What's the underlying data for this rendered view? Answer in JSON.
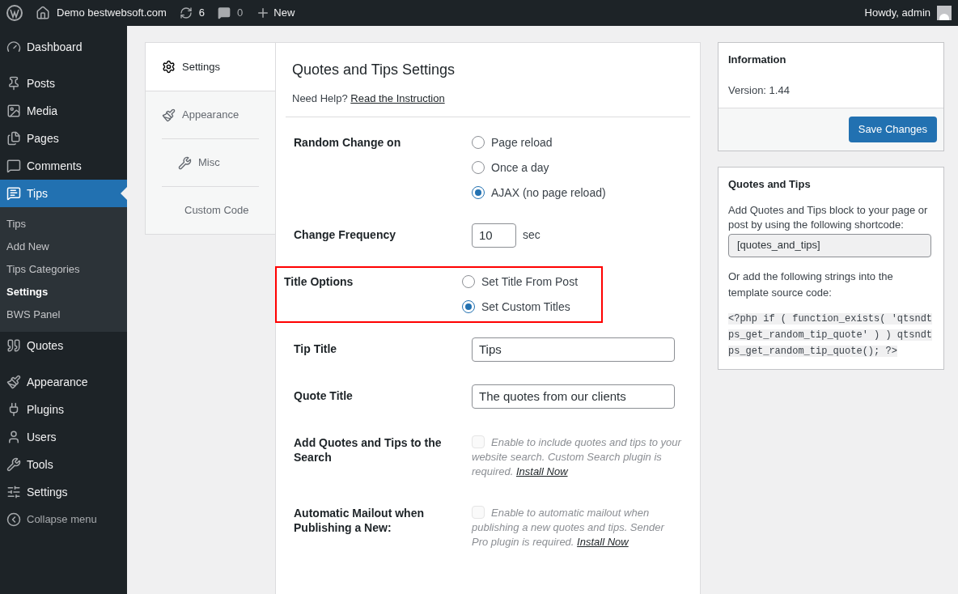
{
  "admin_bar": {
    "site_name": "Demo bestwebsoft.com",
    "updates_count": "6",
    "comments_count": "0",
    "new_label": "New",
    "greeting": "Howdy, admin"
  },
  "sidebar": {
    "items": [
      {
        "label": "Dashboard",
        "selected": false
      },
      {
        "label": "Posts",
        "selected": false
      },
      {
        "label": "Media",
        "selected": false
      },
      {
        "label": "Pages",
        "selected": false
      },
      {
        "label": "Comments",
        "selected": false
      },
      {
        "label": "Tips",
        "selected": true,
        "children": [
          {
            "label": "Tips",
            "selected": false
          },
          {
            "label": "Add New",
            "selected": false
          },
          {
            "label": "Tips Categories",
            "selected": false
          },
          {
            "label": "Settings",
            "selected": true
          },
          {
            "label": "BWS Panel",
            "selected": false
          }
        ]
      },
      {
        "label": "Quotes",
        "selected": false
      },
      {
        "label": "Appearance",
        "selected": false
      },
      {
        "label": "Plugins",
        "selected": false
      },
      {
        "label": "Users",
        "selected": false
      },
      {
        "label": "Tools",
        "selected": false
      },
      {
        "label": "Settings",
        "selected": false
      }
    ],
    "collapse_label": "Collapse menu"
  },
  "tabs": [
    {
      "label": "Settings",
      "selected": true
    },
    {
      "label": "Appearance",
      "selected": false
    },
    {
      "label": "Misc",
      "selected": false
    },
    {
      "label": "Custom Code",
      "selected": false
    }
  ],
  "settings": {
    "title": "Quotes and Tips Settings",
    "help_text": "Need Help?",
    "help_link": "Read the Instruction",
    "fields": [
      {
        "kind": "radio",
        "label": "Random Change on",
        "highlighted": false,
        "options": [
          {
            "label": "Page reload",
            "selected": false
          },
          {
            "label": "Once a day",
            "selected": false
          },
          {
            "label": "AJAX (no page reload)",
            "selected": true
          }
        ]
      },
      {
        "kind": "number",
        "label": "Change Frequency",
        "highlighted": false,
        "value": "10",
        "unit": "sec"
      },
      {
        "kind": "radio",
        "label": "Title Options",
        "highlighted": true,
        "options": [
          {
            "label": "Set Title From Post",
            "selected": false
          },
          {
            "label": "Set Custom Titles",
            "selected": true
          }
        ]
      },
      {
        "kind": "text",
        "label": "Tip Title",
        "highlighted": false,
        "value": "Tips"
      },
      {
        "kind": "text",
        "label": "Quote Title",
        "highlighted": false,
        "value": "The quotes from our clients"
      },
      {
        "kind": "checkbox",
        "label": "Add Quotes and Tips to the Search",
        "highlighted": false,
        "checked": false,
        "disabled": true,
        "description": "Enable to include quotes and tips to your website search. Custom Search plugin is required.",
        "link": "Install Now"
      },
      {
        "kind": "checkbox",
        "label": "Automatic Mailout when Publishing a New:",
        "highlighted": false,
        "checked": false,
        "disabled": true,
        "description": "Enable to automatic mailout when publishing a new quotes and tips. Sender Pro plugin is required.",
        "link": "Install Now"
      }
    ]
  },
  "information": {
    "title": "Information",
    "version": "Version: 1.44",
    "button": "Save Changes"
  },
  "shortcode_box": {
    "title": "Quotes and Tips",
    "intro": "Add Quotes and Tips block to your page or post by using the following shortcode:",
    "shortcode": "[quotes_and_tips]",
    "outro": "Or add the following strings into the template source code:",
    "code": "<?php if ( function_exists( 'qtsndtps_get_random_tip_quote' ) ) qtsndtps_get_random_tip_quote(); ?>"
  }
}
